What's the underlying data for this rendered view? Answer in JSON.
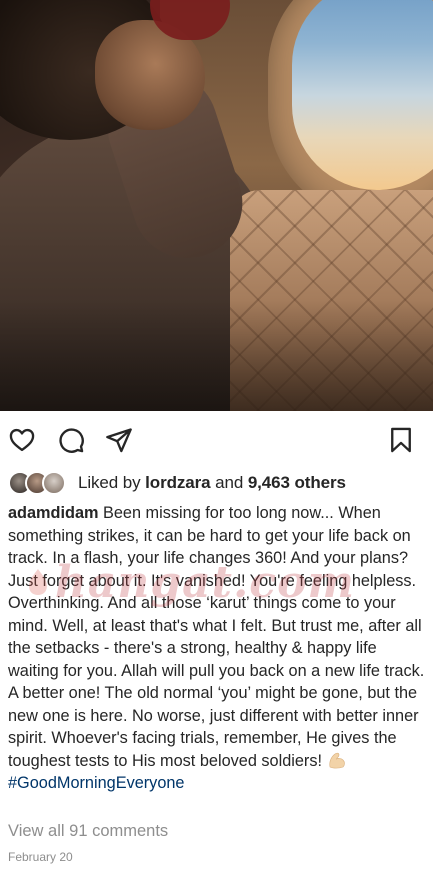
{
  "post": {
    "actions": {
      "like_icon": "heart-outline-icon",
      "comment_icon": "comment-bubble-icon",
      "share_icon": "paper-plane-icon",
      "save_icon": "bookmark-icon"
    },
    "likes": {
      "prefix": "Liked by ",
      "liker": "lordzara",
      "middle": " and ",
      "others": "9,463 others"
    },
    "caption": {
      "username": "adamdidam",
      "text": " Been missing for too long now... When something strikes, it can be hard to get your life back on track. In a flash, your life changes 360! And your plans? Just forget about it. It's vanished! You're feeling helpless. Overthinking. And all those ‘karut’ things come to your mind. Well, at least that's what I felt. But trust me, after all the setbacks - there's a strong, healthy & happy life waiting for you. Allah will pull you back on a new life track. A better one! The old normal ‘you’ might be gone, but the new one is here. No worse, just different with better inner spirit. Whoever's facing trials, remember, He gives the toughest tests to His most beloved soldiers! ",
      "hashtag": "#GoodMorningEveryone"
    },
    "watermark": "hangat.com",
    "view_comments": "View all 91 comments",
    "date": "February 20"
  },
  "colors": {
    "text": "#262626",
    "muted": "#8e8e8e",
    "hashtag": "#003569"
  }
}
